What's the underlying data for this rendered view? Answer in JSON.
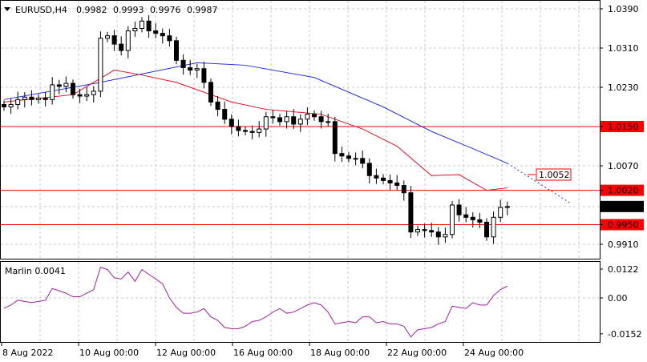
{
  "header": {
    "symbol": "EURUSD,H4",
    "open": "0.9982",
    "high": "0.9993",
    "low": "0.9976",
    "close": "0.9987"
  },
  "indicator": {
    "label": "Marlin 0.0041"
  },
  "price_axis": {
    "ticks": [
      "1.0390",
      "1.0310",
      "1.0230",
      "1.0150",
      "1.0070",
      "0.9910"
    ],
    "tick_values": [
      1.039,
      1.031,
      1.023,
      1.015,
      1.007,
      0.991
    ],
    "levels": [
      {
        "label": "1.0150",
        "value": 1.015
      },
      {
        "label": "1.0020",
        "value": 1.002
      },
      {
        "label": "0.9950",
        "value": 0.995
      }
    ],
    "current": {
      "label": "0.9987",
      "value": 0.9987
    },
    "target": {
      "label": "1.0052",
      "value": 1.0052
    }
  },
  "indicator_axis": {
    "ticks": [
      "0.0122",
      "0.00",
      "-0.0152"
    ],
    "tick_values": [
      0.0122,
      0,
      -0.0152
    ]
  },
  "time_axis": [
    "8 Aug 2022",
    "10 Aug 00:00",
    "12 Aug 00:00",
    "16 Aug 00:00",
    "18 Aug 00:00",
    "22 Aug 00:00",
    "24 Aug 00:00"
  ],
  "colors": {
    "level": "#ff0000",
    "ma_fast": "#e01020",
    "ma_slow": "#2030e0",
    "marlin": "#a020a0"
  },
  "chart_data": {
    "type": "candlestick",
    "closes": [
      1.019,
      1.0195,
      1.0205,
      1.021,
      1.0205,
      1.0208,
      1.0205,
      1.0235,
      1.0232,
      1.0238,
      1.0215,
      1.0212,
      1.0215,
      1.0222,
      1.033,
      1.0335,
      1.0318,
      1.0305,
      1.0345,
      1.035,
      1.0365,
      1.0345,
      1.034,
      1.0335,
      1.0325,
      1.0285,
      1.027,
      1.0265,
      1.0268,
      1.024,
      1.02,
      1.0185,
      1.0165,
      1.015,
      1.0142,
      1.014,
      1.0138,
      1.0145,
      1.017,
      1.0168,
      1.016,
      1.017,
      1.0155,
      1.0165,
      1.0175,
      1.017,
      1.016,
      1.016,
      1.0095,
      1.009,
      1.0085,
      1.0085,
      1.0075,
      1.005,
      1.0045,
      1.004,
      1.0035,
      1.003,
      1.0015,
      0.9935,
      0.994,
      0.9938,
      0.9935,
      0.9925,
      0.993,
      0.999,
      0.997,
      0.9965,
      0.996,
      0.9955,
      0.9925,
      0.9965,
      0.9985,
      0.9987
    ],
    "ma_slow": [
      [
        0,
        1.0205
      ],
      [
        14,
        1.024
      ],
      [
        28,
        1.028
      ],
      [
        35,
        1.0275
      ],
      [
        45,
        1.025
      ],
      [
        55,
        1.019
      ],
      [
        62,
        1.014
      ],
      [
        68,
        1.0105
      ],
      [
        73,
        1.0075
      ]
    ],
    "ma_slow_projection": [
      [
        73,
        1.0075
      ],
      [
        82,
        0.9995
      ]
    ],
    "ma_fast": [
      [
        0,
        1.02
      ],
      [
        10,
        1.0215
      ],
      [
        16,
        1.0265
      ],
      [
        20,
        1.0255
      ],
      [
        25,
        1.024
      ],
      [
        30,
        1.0215
      ],
      [
        33,
        1.02
      ],
      [
        38,
        1.0185
      ],
      [
        46,
        1.0175
      ],
      [
        52,
        1.0145
      ],
      [
        57,
        1.011
      ],
      [
        62,
        1.005
      ],
      [
        66,
        1.0052
      ],
      [
        70,
        1.002
      ],
      [
        73,
        1.0025
      ]
    ],
    "marlin": [
      -0.0044,
      -0.003,
      -0.001,
      -0.0015,
      -0.002,
      -0.0015,
      -0.001,
      0.004,
      0.003,
      0.002,
      0.0005,
      0.0005,
      0.002,
      0.0035,
      0.013,
      0.012,
      0.0085,
      0.008,
      0.011,
      0.007,
      0.012,
      0.01,
      0.008,
      0.006,
      0.0,
      -0.004,
      -0.0065,
      -0.0065,
      -0.006,
      -0.0045,
      -0.008,
      -0.0095,
      -0.0125,
      -0.013,
      -0.013,
      -0.012,
      -0.01,
      -0.0095,
      -0.008,
      -0.006,
      -0.0045,
      -0.0065,
      -0.006,
      -0.0045,
      -0.003,
      -0.002,
      -0.003,
      -0.006,
      -0.011,
      -0.0105,
      -0.01,
      -0.0105,
      -0.008,
      -0.008,
      -0.0105,
      -0.01,
      -0.011,
      -0.011,
      -0.012,
      -0.0165,
      -0.0135,
      -0.013,
      -0.0125,
      -0.011,
      -0.01,
      -0.0035,
      -0.004,
      -0.0045,
      -0.002,
      -0.003,
      -0.003,
      0.001,
      0.0035,
      0.005
    ]
  }
}
